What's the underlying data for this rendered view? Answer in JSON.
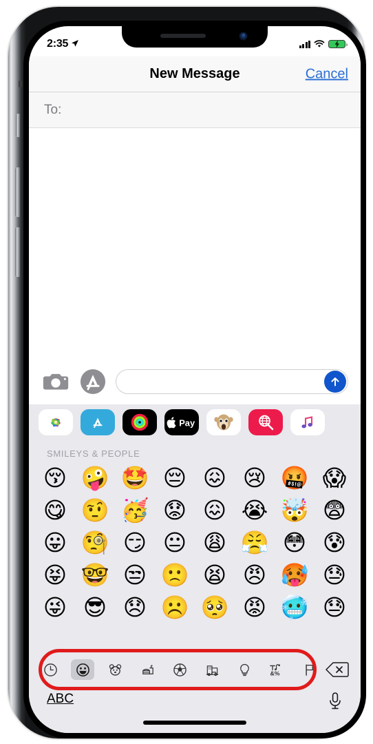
{
  "status_bar": {
    "time": "2:35",
    "location_icon": "location-arrow-icon",
    "signal_icon": "cellular-signal-icon",
    "wifi_icon": "wifi-icon",
    "battery_icon": "battery-charging-icon"
  },
  "nav_bar": {
    "title": "New Message",
    "cancel_label": "Cancel"
  },
  "recipient_field": {
    "label": "To:",
    "value": ""
  },
  "input_bar": {
    "camera_icon": "camera-icon",
    "appstore_icon": "app-store-icon",
    "message_placeholder": "",
    "message_value": "",
    "send_icon": "send-arrow-up-icon"
  },
  "app_strip": {
    "items": [
      {
        "name": "photos-app",
        "label": "Photos"
      },
      {
        "name": "app-store-app",
        "label": "App Store"
      },
      {
        "name": "activity-app",
        "label": "Activity"
      },
      {
        "name": "apple-pay-app",
        "label": "Apple Pay"
      },
      {
        "name": "memoji-app",
        "label": "Memoji"
      },
      {
        "name": "music-search-app",
        "label": "#images"
      },
      {
        "name": "music-app",
        "label": "Music"
      }
    ]
  },
  "emoji_keyboard": {
    "section_header": "SMILEYS & PEOPLE",
    "rows": [
      [
        "😚",
        "🤪",
        "🤩",
        "😔",
        "😖",
        "😢",
        "🤬",
        "😱"
      ],
      [
        "😋",
        "🤨",
        "🥳",
        "😟",
        "😖",
        "😭",
        "🤯",
        "😨"
      ],
      [
        "😛",
        "🧐",
        "😏",
        "😐",
        "😩",
        "😤",
        "😳",
        "😰"
      ],
      [
        "😝",
        "🤓",
        "😒",
        "🙁",
        "😫",
        "😠",
        "🥵",
        "😓"
      ],
      [
        "😜",
        "😎",
        "😞",
        "☹️",
        "🥺",
        "😡",
        "🥶",
        "😓"
      ]
    ],
    "categories": [
      {
        "name": "recents",
        "icon": "clock-icon",
        "active": false
      },
      {
        "name": "smileys-people",
        "icon": "smiley-icon",
        "active": true
      },
      {
        "name": "animals-nature",
        "icon": "bear-icon",
        "active": false
      },
      {
        "name": "food-drink",
        "icon": "food-icon",
        "active": false
      },
      {
        "name": "activity",
        "icon": "soccer-ball-icon",
        "active": false
      },
      {
        "name": "travel-places",
        "icon": "car-building-icon",
        "active": false
      },
      {
        "name": "objects",
        "icon": "lightbulb-icon",
        "active": false
      },
      {
        "name": "symbols",
        "icon": "symbols-icon",
        "active": false
      },
      {
        "name": "flags",
        "icon": "flag-icon",
        "active": false
      }
    ],
    "backspace_icon": "backspace-delete-icon"
  },
  "bottom_bar": {
    "abc_label": "ABC",
    "mic_icon": "microphone-icon"
  },
  "annotation": {
    "shape": "red-oval-highlight",
    "color": "#e01b1b",
    "target": "emoji-category-bar"
  },
  "colors": {
    "accent_blue": "#1155cc",
    "link_blue": "#2b6fd4",
    "keyboard_bg": "#e9e9ee",
    "battery_green": "#34c759",
    "annotation_red": "#e01b1b"
  }
}
